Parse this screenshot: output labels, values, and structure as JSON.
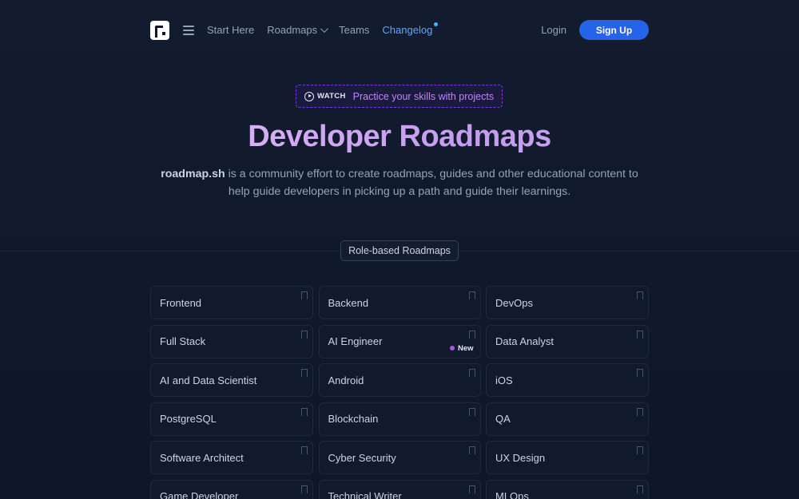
{
  "nav": {
    "links": [
      {
        "label": "Start Here"
      },
      {
        "label": "Roadmaps",
        "dropdown": true
      },
      {
        "label": "Teams"
      },
      {
        "label": "Changelog",
        "highlight": true
      }
    ],
    "login": "Login",
    "signup": "Sign Up"
  },
  "hero": {
    "watch_label": "WATCH",
    "watch_text": "Practice your skills with projects",
    "title": "Developer Roadmaps",
    "subtitle_brand": "roadmap.sh",
    "subtitle_rest": " is a community effort to create roadmaps, guides and other educational content to help guide developers in picking up a path and guide their learnings."
  },
  "section": {
    "label": "Role-based Roadmaps"
  },
  "roadmaps": [
    {
      "label": "Frontend"
    },
    {
      "label": "Backend"
    },
    {
      "label": "DevOps"
    },
    {
      "label": "Full Stack"
    },
    {
      "label": "AI Engineer",
      "badge": "New"
    },
    {
      "label": "Data Analyst"
    },
    {
      "label": "AI and Data Scientist"
    },
    {
      "label": "Android"
    },
    {
      "label": "iOS"
    },
    {
      "label": "PostgreSQL"
    },
    {
      "label": "Blockchain"
    },
    {
      "label": "QA"
    },
    {
      "label": "Software Architect"
    },
    {
      "label": "Cyber Security"
    },
    {
      "label": "UX Design"
    },
    {
      "label": "Game Developer"
    },
    {
      "label": "Technical Writer"
    },
    {
      "label": "MLOps"
    }
  ],
  "colors": {
    "accent": "#2563eb",
    "title_gradient": [
      "#e9c4f8",
      "#c49bf0"
    ],
    "new_dot": "#a855f7",
    "changelog": "#60a5fa"
  },
  "icons": {
    "logo": "roadmap-logo",
    "menu": "hamburger-icon",
    "play": "play-circle-icon",
    "bookmark": "bookmark-icon"
  }
}
